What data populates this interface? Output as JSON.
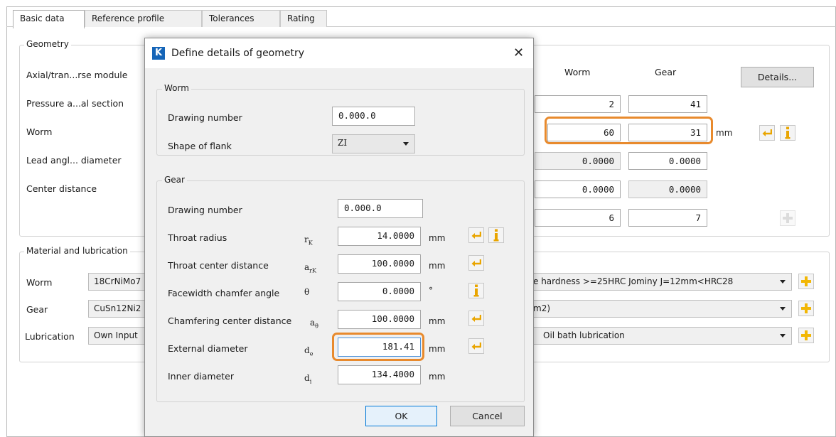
{
  "tabs": [
    "Basic data",
    "Reference profile",
    "Tolerances",
    "Rating"
  ],
  "geometry": {
    "title": "Geometry",
    "labels": [
      "Axial/tran...rse module",
      "Pressure a...al section",
      "Worm",
      "Lead angl... diameter",
      "Center distance"
    ],
    "col_worm": "Worm",
    "col_gear": "Gear",
    "details_button": "Details...",
    "rows": [
      {
        "worm": "2",
        "gear": "41"
      },
      {
        "worm": "60",
        "gear": "31",
        "unit": "mm"
      },
      {
        "worm": "0.0000",
        "gear": "0.0000"
      },
      {
        "worm": "0.0000",
        "gear": "0.0000"
      },
      {
        "worm": "6",
        "gear": "7"
      }
    ]
  },
  "material": {
    "title": "Material and lubrication",
    "labels": [
      "Worm",
      "Gear",
      "Lubrication"
    ],
    "left_values": [
      "18CrNiMo7",
      "CuSn12Ni2",
      "Own Input"
    ],
    "right_values": [
      "e hardness >=25HRC Jominy J=12mm<HRC28",
      "m2)",
      "Oil bath lubrication"
    ]
  },
  "dialog": {
    "title": "Define details of geometry",
    "logo": "K",
    "close": "✕",
    "worm_group": {
      "title": "Worm",
      "drawing_label": "Drawing number",
      "drawing_value": "0.000.0",
      "shape_label": "Shape of flank",
      "shape_value": "ZI"
    },
    "gear_group": {
      "title": "Gear",
      "drawing_label": "Drawing number",
      "drawing_value": "0.000.0",
      "rows": [
        {
          "label": "Throat radius",
          "sym": "r",
          "sub": "K",
          "value": "14.0000",
          "unit": "mm"
        },
        {
          "label": "Throat center distance",
          "sym": "a",
          "sub": "rK",
          "value": "100.0000",
          "unit": "mm"
        },
        {
          "label": "Facewidth chamfer angle",
          "sym": "θ",
          "sub": "",
          "value": "0.0000",
          "unit": "°"
        },
        {
          "label": "Chamfering center distance",
          "sym": "a",
          "sub": "θ",
          "value": "100.0000",
          "unit": "mm"
        },
        {
          "label": "External diameter",
          "sym": "d",
          "sub": "e",
          "value": "181.41",
          "unit": "mm"
        },
        {
          "label": "Inner diameter",
          "sym": "d",
          "sub": "i",
          "value": "134.4000",
          "unit": "mm"
        }
      ]
    },
    "ok": "OK",
    "cancel": "Cancel"
  },
  "colors": {
    "highlight": "#e88a2d",
    "accent": "#1565b8",
    "icon_yellow": "#f2b705"
  }
}
